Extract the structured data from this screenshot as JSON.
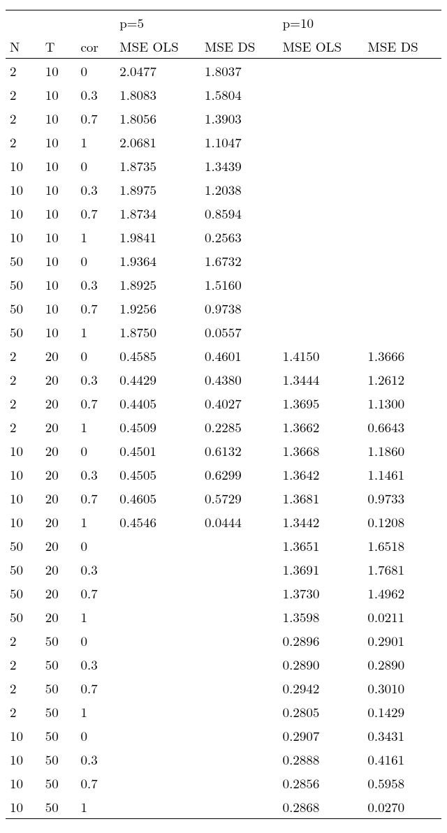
{
  "chart_data": {
    "type": "table",
    "title": "",
    "columns": [
      "N",
      "T",
      "cor",
      "MSE OLS (p=5)",
      "MSE DS (p=5)",
      "MSE OLS (p=10)",
      "MSE DS (p=10)"
    ],
    "rows": [
      {
        "N": 2,
        "T": 10,
        "cor": 0,
        "p5_ols": 2.0477,
        "p5_ds": 1.8037,
        "p10_ols": null,
        "p10_ds": null
      },
      {
        "N": 2,
        "T": 10,
        "cor": 0.3,
        "p5_ols": 1.8083,
        "p5_ds": 1.5804,
        "p10_ols": null,
        "p10_ds": null
      },
      {
        "N": 2,
        "T": 10,
        "cor": 0.7,
        "p5_ols": 1.8056,
        "p5_ds": 1.3903,
        "p10_ols": null,
        "p10_ds": null
      },
      {
        "N": 2,
        "T": 10,
        "cor": 1,
        "p5_ols": 2.0681,
        "p5_ds": 1.1047,
        "p10_ols": null,
        "p10_ds": null
      },
      {
        "N": 10,
        "T": 10,
        "cor": 0,
        "p5_ols": 1.8735,
        "p5_ds": 1.3439,
        "p10_ols": null,
        "p10_ds": null
      },
      {
        "N": 10,
        "T": 10,
        "cor": 0.3,
        "p5_ols": 1.8975,
        "p5_ds": 1.2038,
        "p10_ols": null,
        "p10_ds": null
      },
      {
        "N": 10,
        "T": 10,
        "cor": 0.7,
        "p5_ols": 1.8734,
        "p5_ds": 0.8594,
        "p10_ols": null,
        "p10_ds": null
      },
      {
        "N": 10,
        "T": 10,
        "cor": 1,
        "p5_ols": 1.9841,
        "p5_ds": 0.2563,
        "p10_ols": null,
        "p10_ds": null
      },
      {
        "N": 50,
        "T": 10,
        "cor": 0,
        "p5_ols": 1.9364,
        "p5_ds": 1.6732,
        "p10_ols": null,
        "p10_ds": null
      },
      {
        "N": 50,
        "T": 10,
        "cor": 0.3,
        "p5_ols": 1.8925,
        "p5_ds": 1.516,
        "p10_ols": null,
        "p10_ds": null
      },
      {
        "N": 50,
        "T": 10,
        "cor": 0.7,
        "p5_ols": 1.9256,
        "p5_ds": 0.9738,
        "p10_ols": null,
        "p10_ds": null
      },
      {
        "N": 50,
        "T": 10,
        "cor": 1,
        "p5_ols": 1.875,
        "p5_ds": 0.0557,
        "p10_ols": null,
        "p10_ds": null
      },
      {
        "N": 2,
        "T": 20,
        "cor": 0,
        "p5_ols": 0.4585,
        "p5_ds": 0.4601,
        "p10_ols": 1.415,
        "p10_ds": 1.3666
      },
      {
        "N": 2,
        "T": 20,
        "cor": 0.3,
        "p5_ols": 0.4429,
        "p5_ds": 0.438,
        "p10_ols": 1.3444,
        "p10_ds": 1.2612
      },
      {
        "N": 2,
        "T": 20,
        "cor": 0.7,
        "p5_ols": 0.4405,
        "p5_ds": 0.4027,
        "p10_ols": 1.3695,
        "p10_ds": 1.13
      },
      {
        "N": 2,
        "T": 20,
        "cor": 1,
        "p5_ols": 0.4509,
        "p5_ds": 0.2285,
        "p10_ols": 1.3662,
        "p10_ds": 0.6643
      },
      {
        "N": 10,
        "T": 20,
        "cor": 0,
        "p5_ols": 0.4501,
        "p5_ds": 0.6132,
        "p10_ols": 1.3668,
        "p10_ds": 1.186
      },
      {
        "N": 10,
        "T": 20,
        "cor": 0.3,
        "p5_ols": 0.4505,
        "p5_ds": 0.6299,
        "p10_ols": 1.3642,
        "p10_ds": 1.1461
      },
      {
        "N": 10,
        "T": 20,
        "cor": 0.7,
        "p5_ols": 0.4605,
        "p5_ds": 0.5729,
        "p10_ols": 1.3681,
        "p10_ds": 0.9733
      },
      {
        "N": 10,
        "T": 20,
        "cor": 1,
        "p5_ols": 0.4546,
        "p5_ds": 0.0444,
        "p10_ols": 1.3442,
        "p10_ds": 0.1208
      },
      {
        "N": 50,
        "T": 20,
        "cor": 0,
        "p5_ols": null,
        "p5_ds": null,
        "p10_ols": 1.3651,
        "p10_ds": 1.6518
      },
      {
        "N": 50,
        "T": 20,
        "cor": 0.3,
        "p5_ols": null,
        "p5_ds": null,
        "p10_ols": 1.3691,
        "p10_ds": 1.7681
      },
      {
        "N": 50,
        "T": 20,
        "cor": 0.7,
        "p5_ols": null,
        "p5_ds": null,
        "p10_ols": 1.373,
        "p10_ds": 1.4962
      },
      {
        "N": 50,
        "T": 20,
        "cor": 1,
        "p5_ols": null,
        "p5_ds": null,
        "p10_ols": 1.3598,
        "p10_ds": 0.0211
      },
      {
        "N": 2,
        "T": 50,
        "cor": 0,
        "p5_ols": null,
        "p5_ds": null,
        "p10_ols": 0.2896,
        "p10_ds": 0.2901
      },
      {
        "N": 2,
        "T": 50,
        "cor": 0.3,
        "p5_ols": null,
        "p5_ds": null,
        "p10_ols": 0.289,
        "p10_ds": 0.289
      },
      {
        "N": 2,
        "T": 50,
        "cor": 0.7,
        "p5_ols": null,
        "p5_ds": null,
        "p10_ols": 0.2942,
        "p10_ds": 0.301
      },
      {
        "N": 2,
        "T": 50,
        "cor": 1,
        "p5_ols": null,
        "p5_ds": null,
        "p10_ols": 0.2805,
        "p10_ds": 0.1429
      },
      {
        "N": 10,
        "T": 50,
        "cor": 0,
        "p5_ols": null,
        "p5_ds": null,
        "p10_ols": 0.2907,
        "p10_ds": 0.3431
      },
      {
        "N": 10,
        "T": 50,
        "cor": 0.3,
        "p5_ols": null,
        "p5_ds": null,
        "p10_ols": 0.2888,
        "p10_ds": 0.4161
      },
      {
        "N": 10,
        "T": 50,
        "cor": 0.7,
        "p5_ols": null,
        "p5_ds": null,
        "p10_ols": 0.2856,
        "p10_ds": 0.5958
      },
      {
        "N": 10,
        "T": 50,
        "cor": 1,
        "p5_ols": null,
        "p5_ds": null,
        "p10_ols": 0.2868,
        "p10_ds": 0.027
      }
    ]
  },
  "header": {
    "p5": "p=5",
    "p10": "p=10",
    "n": "N",
    "t": "T",
    "cor": "cor",
    "mse_ols": "MSE OLS",
    "mse_ds": "MSE DS"
  }
}
